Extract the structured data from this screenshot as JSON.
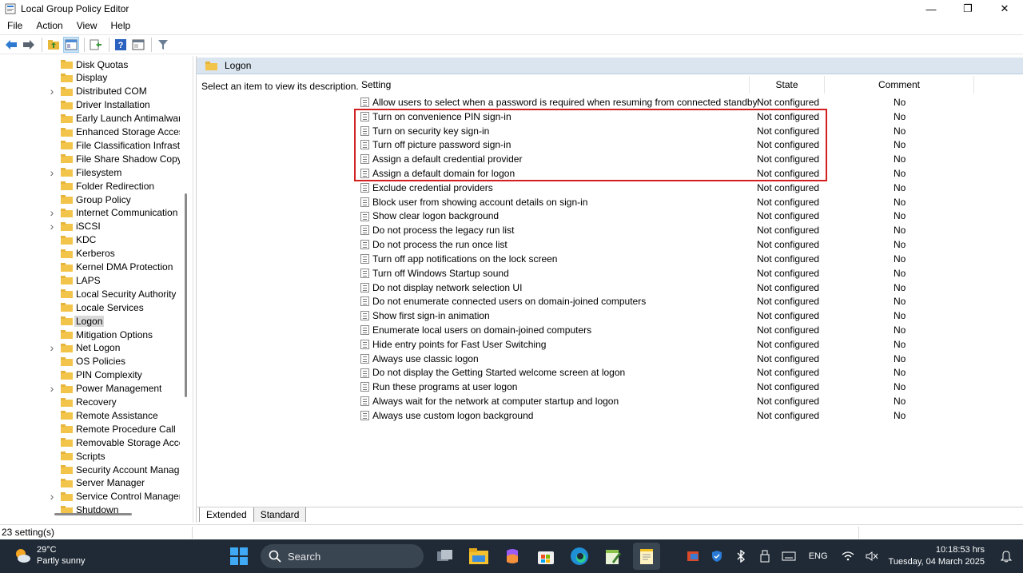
{
  "window": {
    "title": "Local Group Policy Editor",
    "minimize_glyph": "—",
    "maximize_glyph": "❐",
    "close_glyph": "✕"
  },
  "menu": [
    "File",
    "Action",
    "View",
    "Help"
  ],
  "toolbar": {
    "icons": [
      "back-arrow-icon",
      "forward-arrow-icon",
      "up-folder-icon",
      "show-hide-tree-icon",
      "export-list-icon",
      "help-icon",
      "properties-icon",
      "filter-icon"
    ]
  },
  "tree": {
    "items": [
      {
        "label": "Disk Quotas",
        "expandable": false
      },
      {
        "label": "Display",
        "expandable": false
      },
      {
        "label": "Distributed COM",
        "expandable": true
      },
      {
        "label": "Driver Installation",
        "expandable": false
      },
      {
        "label": "Early Launch Antimalware",
        "expandable": false
      },
      {
        "label": "Enhanced Storage Access",
        "expandable": false
      },
      {
        "label": "File Classification Infrastru",
        "expandable": false
      },
      {
        "label": "File Share Shadow Copy P",
        "expandable": false
      },
      {
        "label": "Filesystem",
        "expandable": true
      },
      {
        "label": "Folder Redirection",
        "expandable": false
      },
      {
        "label": "Group Policy",
        "expandable": false
      },
      {
        "label": "Internet Communication M",
        "expandable": true
      },
      {
        "label": "iSCSI",
        "expandable": true
      },
      {
        "label": "KDC",
        "expandable": false
      },
      {
        "label": "Kerberos",
        "expandable": false
      },
      {
        "label": "Kernel DMA Protection",
        "expandable": false
      },
      {
        "label": "LAPS",
        "expandable": false
      },
      {
        "label": "Local Security Authority",
        "expandable": false
      },
      {
        "label": "Locale Services",
        "expandable": false
      },
      {
        "label": "Logon",
        "expandable": false,
        "selected": true
      },
      {
        "label": "Mitigation Options",
        "expandable": false
      },
      {
        "label": "Net Logon",
        "expandable": true
      },
      {
        "label": "OS Policies",
        "expandable": false
      },
      {
        "label": "PIN Complexity",
        "expandable": false
      },
      {
        "label": "Power Management",
        "expandable": true
      },
      {
        "label": "Recovery",
        "expandable": false
      },
      {
        "label": "Remote Assistance",
        "expandable": false
      },
      {
        "label": "Remote Procedure Call",
        "expandable": false
      },
      {
        "label": "Removable Storage Acces",
        "expandable": false
      },
      {
        "label": "Scripts",
        "expandable": false
      },
      {
        "label": "Security Account Manage",
        "expandable": false
      },
      {
        "label": "Server Manager",
        "expandable": false
      },
      {
        "label": "Service Control Manager S",
        "expandable": true
      },
      {
        "label": "Shutdown",
        "expandable": false
      }
    ]
  },
  "right_pane": {
    "header_title": "Logon",
    "description": "Select an item to view its description.",
    "columns": {
      "setting": "Setting",
      "state": "State",
      "comment": "Comment"
    },
    "rows": [
      {
        "name": "Allow users to select when a password is required when resuming from connected standby",
        "state": "Not configured",
        "comment": "No"
      },
      {
        "name": "Turn on convenience PIN sign-in",
        "state": "Not configured",
        "comment": "No"
      },
      {
        "name": "Turn on security key sign-in",
        "state": "Not configured",
        "comment": "No"
      },
      {
        "name": "Turn off picture password sign-in",
        "state": "Not configured",
        "comment": "No"
      },
      {
        "name": "Assign a default credential provider",
        "state": "Not configured",
        "comment": "No"
      },
      {
        "name": "Assign a default domain for logon",
        "state": "Not configured",
        "comment": "No"
      },
      {
        "name": "Exclude credential providers",
        "state": "Not configured",
        "comment": "No"
      },
      {
        "name": "Block user from showing account details on sign-in",
        "state": "Not configured",
        "comment": "No"
      },
      {
        "name": "Show clear logon background",
        "state": "Not configured",
        "comment": "No"
      },
      {
        "name": "Do not process the legacy run list",
        "state": "Not configured",
        "comment": "No"
      },
      {
        "name": "Do not process the run once list",
        "state": "Not configured",
        "comment": "No"
      },
      {
        "name": "Turn off app notifications on the lock screen",
        "state": "Not configured",
        "comment": "No"
      },
      {
        "name": "Turn off Windows Startup sound",
        "state": "Not configured",
        "comment": "No"
      },
      {
        "name": "Do not display network selection UI",
        "state": "Not configured",
        "comment": "No"
      },
      {
        "name": "Do not enumerate connected users on domain-joined computers",
        "state": "Not configured",
        "comment": "No"
      },
      {
        "name": "Show first sign-in animation",
        "state": "Not configured",
        "comment": "No"
      },
      {
        "name": "Enumerate local users on domain-joined computers",
        "state": "Not configured",
        "comment": "No"
      },
      {
        "name": "Hide entry points for Fast User Switching",
        "state": "Not configured",
        "comment": "No"
      },
      {
        "name": "Always use classic logon",
        "state": "Not configured",
        "comment": "No"
      },
      {
        "name": "Do not display the Getting Started welcome screen at logon",
        "state": "Not configured",
        "comment": "No"
      },
      {
        "name": "Run these programs at user logon",
        "state": "Not configured",
        "comment": "No"
      },
      {
        "name": "Always wait for the network at computer startup and logon",
        "state": "Not configured",
        "comment": "No"
      },
      {
        "name": "Always use custom logon background",
        "state": "Not configured",
        "comment": "No"
      }
    ],
    "highlight_color": "#d21f1f"
  },
  "tabs": {
    "extended": "Extended",
    "standard": "Standard"
  },
  "status": {
    "text": "23 setting(s)"
  },
  "taskbar": {
    "weather_temp": "29°C",
    "weather_desc": "Partly sunny",
    "search_label": "Search",
    "language": "ENG",
    "time": "10:18:53 hrs",
    "date": "Tuesday, 04 March 2025",
    "app_icons": [
      "windows-start-icon",
      "task-view-icon",
      "file-explorer-icon",
      "copilot-icon",
      "microsoft-store-icon",
      "edge-icon",
      "notepad-plus-icon",
      "notepad-icon"
    ],
    "tray_icons": [
      "office-tray-icon",
      "defender-tray-icon",
      "bluetooth-icon",
      "usb-icon",
      "keyboard-icon",
      "wifi-icon",
      "speaker-muted-icon",
      "notification-bell-icon"
    ]
  },
  "colors": {
    "accent": "#0078d4",
    "folder": "#f3c44a",
    "header_bg": "#dae5f0",
    "taskbar_bg": "#1f2a36"
  }
}
